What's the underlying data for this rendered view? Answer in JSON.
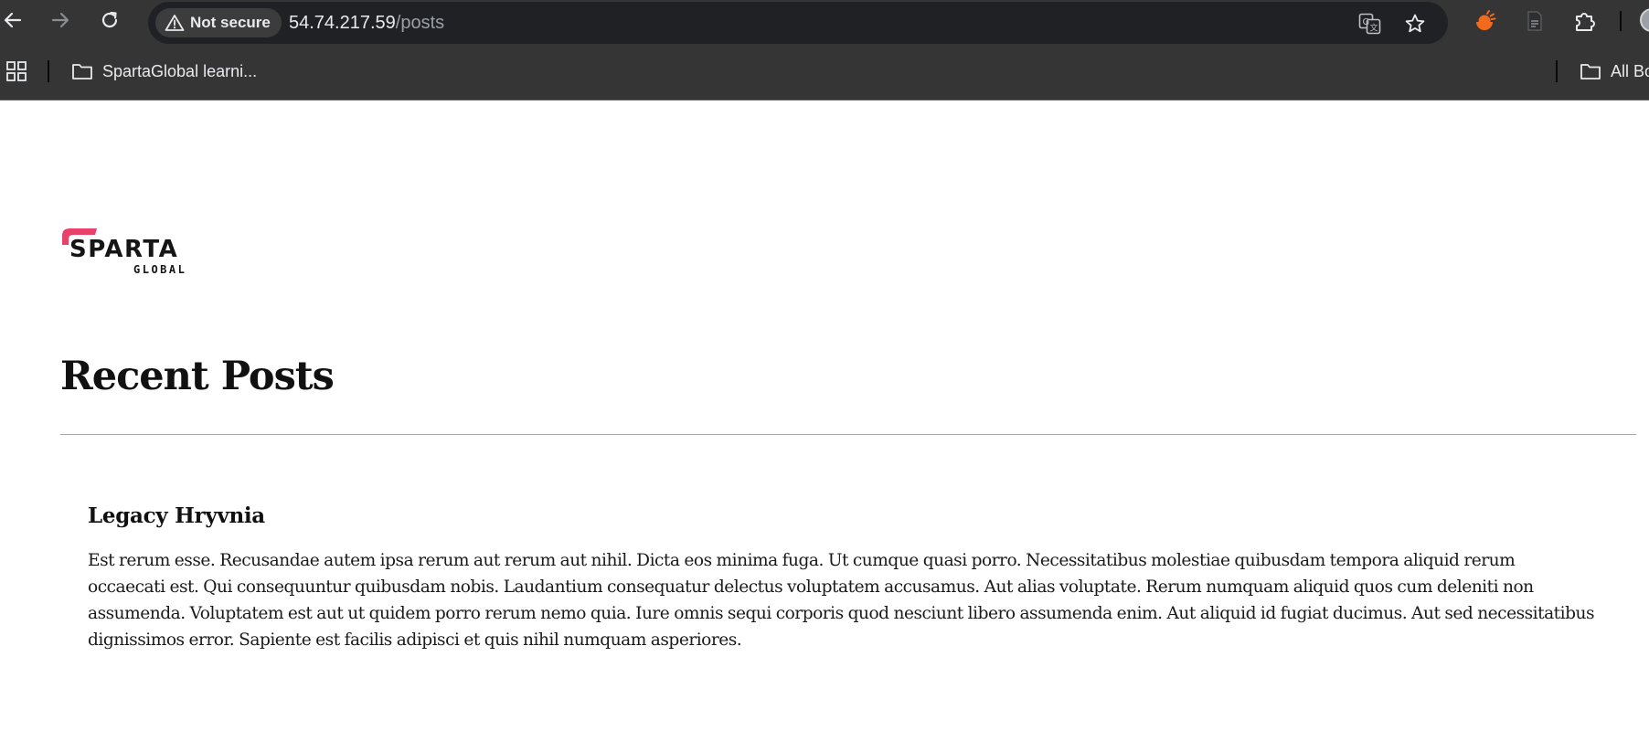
{
  "browser": {
    "security_label": "Not secure",
    "url_host": "54.74.217.59",
    "url_path": "/posts",
    "icons": {
      "back": "back-arrow-icon",
      "forward": "forward-arrow-icon",
      "reload": "reload-icon",
      "warning": "warning-icon",
      "translate": "translate-icon",
      "bookmark_star": "star-icon",
      "extension_1": "orange-extension-icon",
      "extension_2": "document-extension-icon",
      "extensions": "puzzle-icon",
      "profile": "profile-avatar-icon"
    }
  },
  "bookmarks_bar": {
    "items": [
      {
        "label": "SpartaGlobal learni...",
        "icon": "folder-icon"
      },
      {
        "label": "All Bo",
        "icon": "folder-icon"
      }
    ]
  },
  "page": {
    "logo_text": "SPARTA",
    "logo_subtext": "GLOBAL",
    "title": "Recent Posts",
    "posts": [
      {
        "title": "Legacy Hryvnia",
        "body": "Est rerum esse. Recusandae autem ipsa rerum aut rerum aut nihil. Dicta eos minima fuga. Ut cumque quasi porro. Necessitatibus molestiae quibusdam tempora aliquid rerum occaecati est. Qui consequuntur quibusdam nobis. Laudantium consequatur delectus voluptatem accusamus. Aut alias voluptate. Rerum numquam aliquid quos cum deleniti non assumenda. Voluptatem est aut ut quidem porro rerum nemo quia. Iure omnis sequi corporis quod nesciunt libero assumenda enim. Aut aliquid id fugiat ducimus. Aut sed necessitatibus dignissimos error. Sapiente est facilis adipisci et quis nihil numquam asperiores."
      }
    ]
  },
  "colors": {
    "chrome_bg": "#353535",
    "omnibox_bg": "#202124",
    "logo_accent": "#e8416a",
    "extension_orange": "#f26b1d"
  }
}
